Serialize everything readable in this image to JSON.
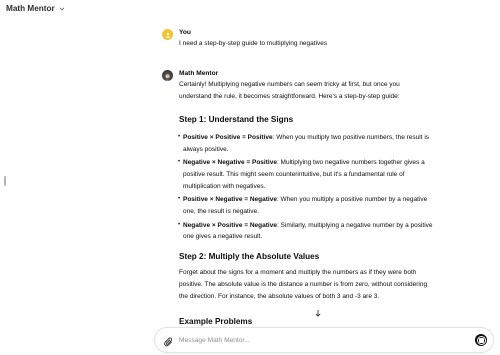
{
  "header": {
    "title": "Math Mentor"
  },
  "user_message": {
    "author": "You",
    "text": "I need a step-by-step guide to multiplying negatives"
  },
  "assistant_message": {
    "author": "Math Mentor",
    "intro_line1": "Certainly! Multiplying negative numbers can seem tricky at first, but once you",
    "intro_line2": "understand the rule, it becomes straightforward. Here's a step-by-step guide:",
    "step1_title": "Step 1: Understand the Signs",
    "rules": [
      {
        "bold": "Positive × Positive = Positive",
        "line1": ": When you multiply two positive numbers, the result is",
        "line2": "always positive.",
        "line3": ""
      },
      {
        "bold": "Negative × Negative = Positive",
        "line1": ": Multiplying two negative numbers together gives a",
        "line2": "positive result. This might seem counterintuitive, but it's a fundamental rule of",
        "line3": "multiplication with negatives."
      },
      {
        "bold": "Positive × Negative = Negative",
        "line1": ": When you multiply a positive number by a negative",
        "line2": "one, the result is negative.",
        "line3": ""
      },
      {
        "bold": "Negative × Positive = Negative",
        "line1": ": Similarly, multiplying a negative number by a positive",
        "line2": "one gives a negative result.",
        "line3": ""
      }
    ],
    "step2_title": "Step 2: Multiply the Absolute Values",
    "step2_line1": "Forget about the signs for a moment and multiply the numbers as if they were both",
    "step2_line2": "positive. The absolute value is the distance a number is from zero, without considering",
    "step2_line3": "the direction. For instance, the absolute values of both 3 and -3 are 3.",
    "example_title": "Example Problems"
  },
  "composer": {
    "placeholder": "Message Math Mentor..."
  },
  "icons": {
    "header_caret": "chevron-down-icon",
    "user_avatar": "user-avatar-icon",
    "bot_avatar": "bot-avatar-icon",
    "scroll": "arrow-down-icon",
    "attach": "paperclip-icon",
    "send": "stop-icon"
  },
  "colors": {
    "user_avatar": "#f4c430",
    "bot_avatar": "#3a3a3a",
    "text": "#0d0d0d"
  }
}
